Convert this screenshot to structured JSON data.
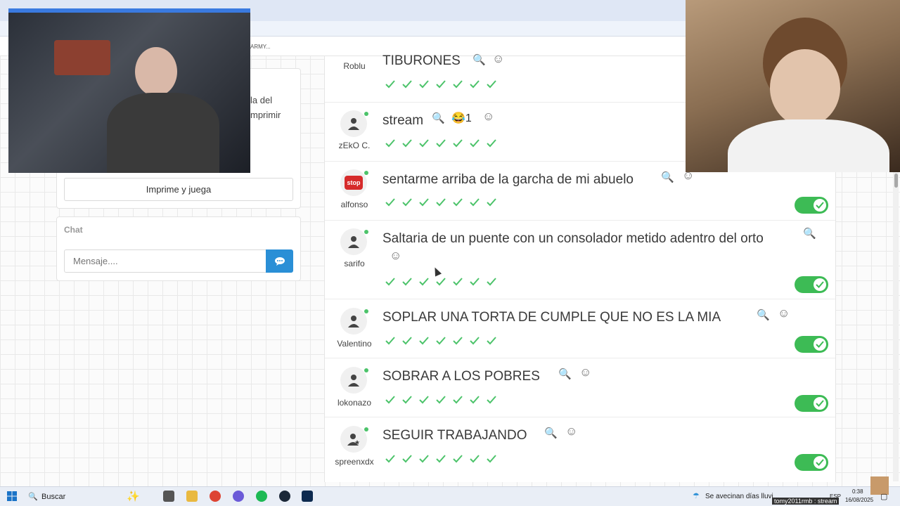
{
  "browser": {
    "bookmark_text": "ARMY..."
  },
  "left_panel": {
    "partial_text_1": "la del",
    "partial_text_2": "mprimir",
    "print_button": "Imprime y juega"
  },
  "chat": {
    "title": "Chat",
    "placeholder": "Mensaje...."
  },
  "rows": [
    {
      "user": "Roblu",
      "answer": "TIBURONES",
      "reactions": "",
      "avatar": "person",
      "toggle": false
    },
    {
      "user": "zEkO C.",
      "answer": "stream",
      "reactions": "😂1",
      "avatar": "person",
      "toggle": false
    },
    {
      "user": "alfonso",
      "answer": "sentarme arriba de la garcha de mi abuelo",
      "reactions": "",
      "avatar": "stop",
      "toggle": true
    },
    {
      "user": "sarifo",
      "answer": "Saltaria de un puente con un consolador metido adentro del orto",
      "reactions": "",
      "avatar": "person",
      "toggle": true
    },
    {
      "user": "Valentino",
      "answer": "SOPLAR UNA TORTA DE CUMPLE QUE NO ES LA MIA",
      "reactions": "",
      "avatar": "person",
      "toggle": true
    },
    {
      "user": "lokonazo",
      "answer": "SOBRAR A LOS POBRES",
      "reactions": "",
      "avatar": "person",
      "toggle": true
    },
    {
      "user": "spreenxdx",
      "answer": "SEGUIR TRABAJANDO",
      "reactions": "",
      "avatar": "person-star",
      "toggle": true
    }
  ],
  "stop_label": "stop",
  "taskbar": {
    "search": "Buscar",
    "weather": "Se avecinan días lluvi...",
    "lang": "ESP",
    "time": "0:38",
    "date": "16/08/2025",
    "stream_overlay": "tomy2011rmb : stream"
  },
  "colors": {
    "accent_blue": "#2a8fd6",
    "check_green": "#4cc36a",
    "toggle_green": "#3dbb55"
  }
}
